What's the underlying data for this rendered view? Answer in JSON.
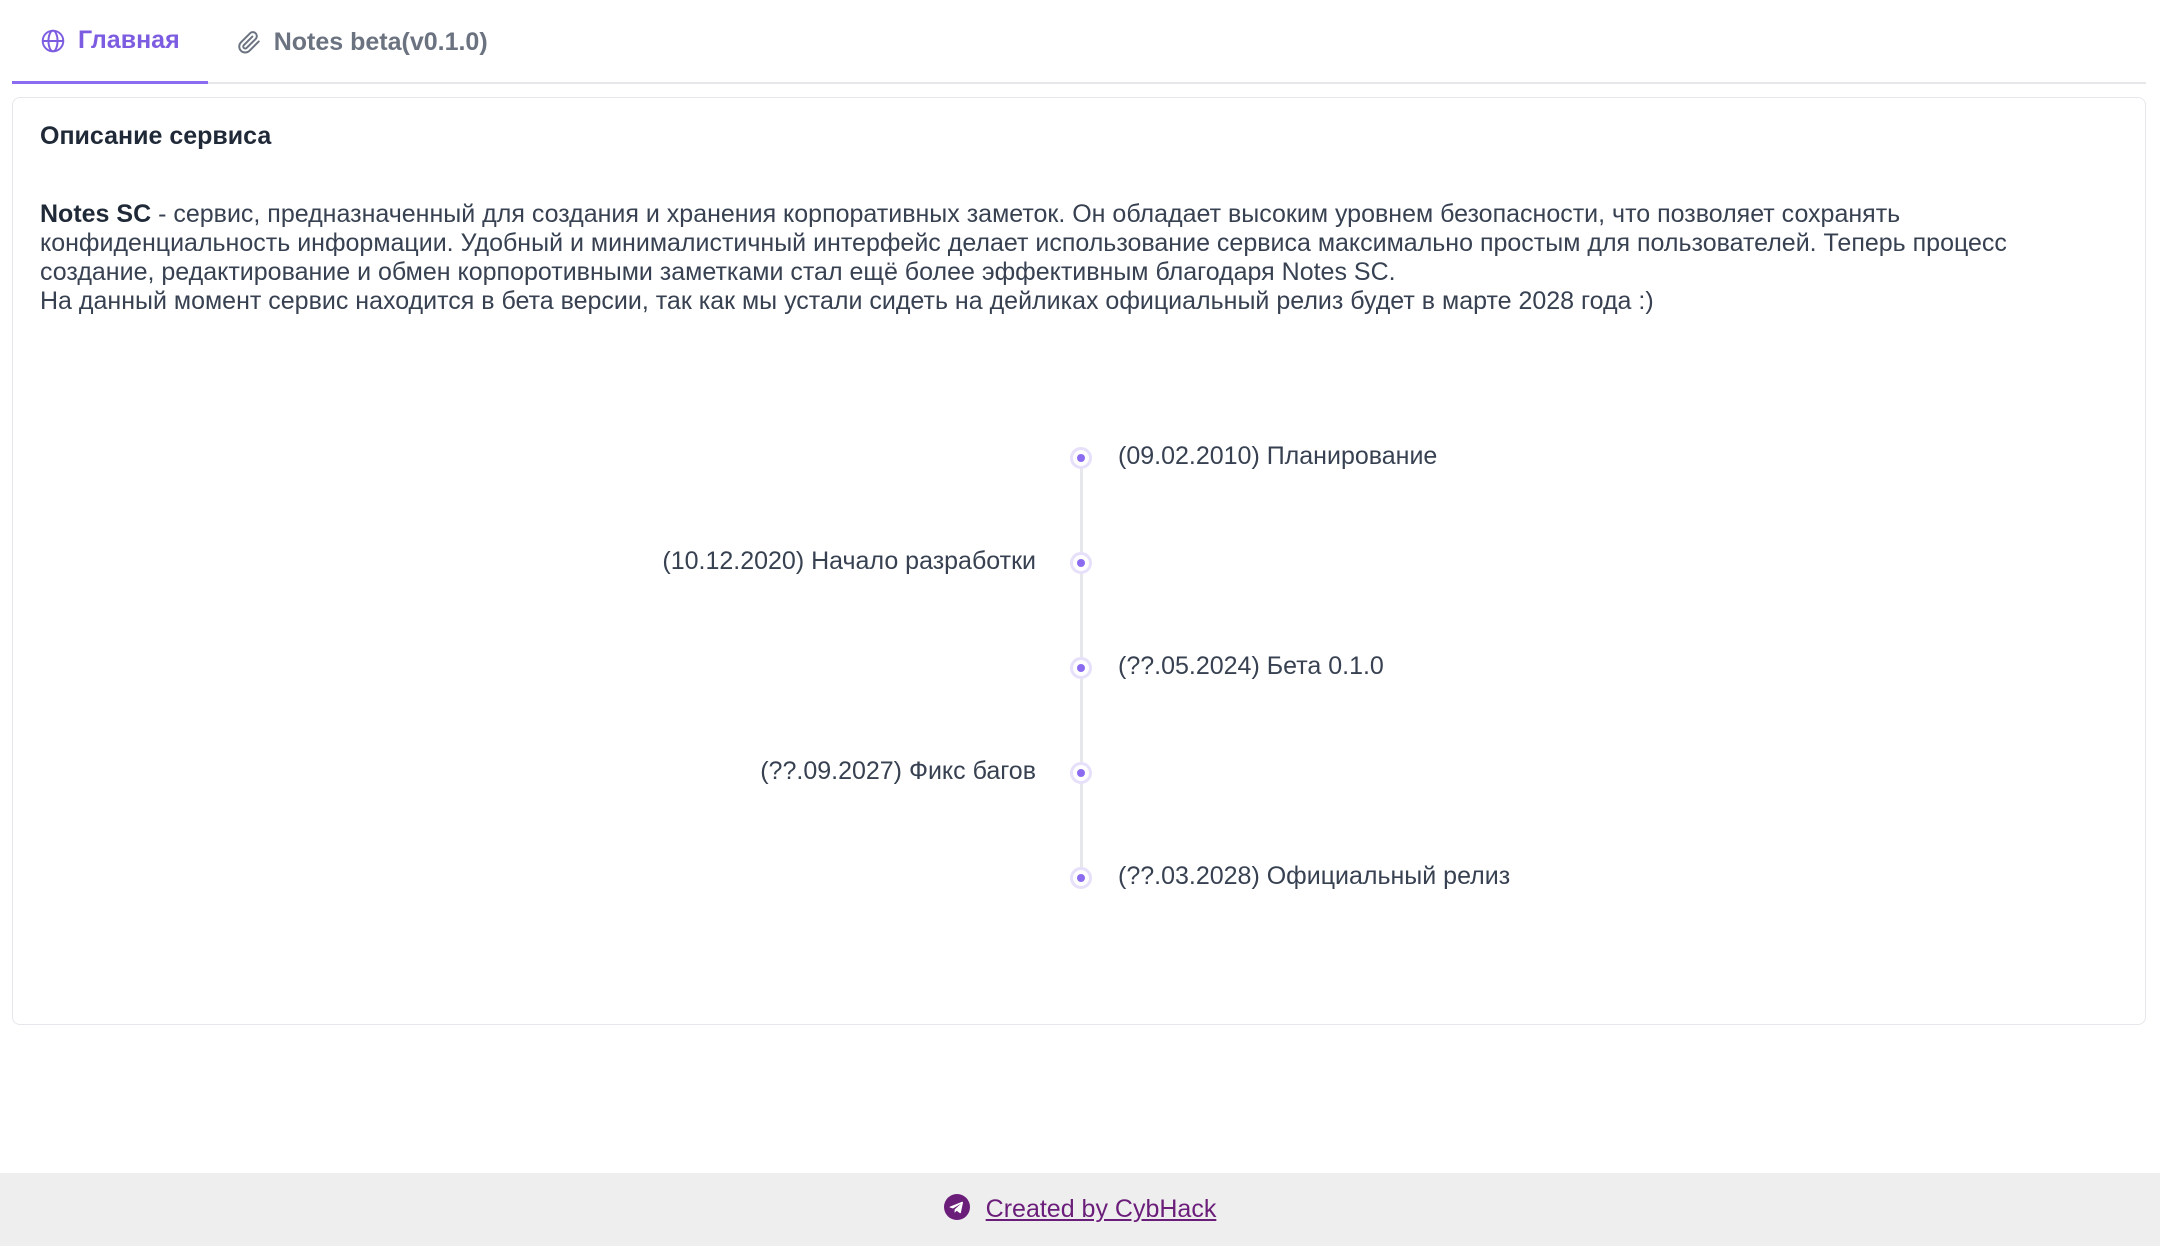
{
  "tabs": [
    {
      "label": "Главная",
      "icon": "globe-icon",
      "active": true
    },
    {
      "label": "Notes beta(v0.1.0)",
      "icon": "paperclip-icon",
      "active": false
    }
  ],
  "card": {
    "title": "Описание сервиса",
    "description": {
      "brand": "Notes SC",
      "line1_rest": " - сервис, предназначенный для создания и хранения корпоративных заметок. Он обладает высоким уровнем безопасности, что позволяет сохранять конфиденциальность информации. Удобный и минималистичный интерфейс делает использование сервиса максимально простым для пользователей. Теперь процесс создание, редактирование и обмен корпоротивными заметками стал ещё более эффективным благодаря Notes SC.",
      "line2": "На данный момент сервис находится в бета версии, так как мы устали сидеть на дейликах официальный релиз будет в марте 2028 года :)"
    }
  },
  "timeline": [
    {
      "label": "(09.02.2010) Планирование",
      "side": "right"
    },
    {
      "label": "(10.12.2020) Начало разработки",
      "side": "left"
    },
    {
      "label": "(??.05.2024) Бета 0.1.0",
      "side": "right"
    },
    {
      "label": "(??.09.2027) Фикс багов",
      "side": "left"
    },
    {
      "label": "(??.03.2028) Официальный релиз",
      "side": "right"
    }
  ],
  "footer": {
    "link_label": "Created by CybHack",
    "icon": "telegram-icon"
  },
  "colors": {
    "accent": "#8b6cf0",
    "footer_link": "#6b1d7a",
    "footer_bg": "#eeeeee"
  }
}
